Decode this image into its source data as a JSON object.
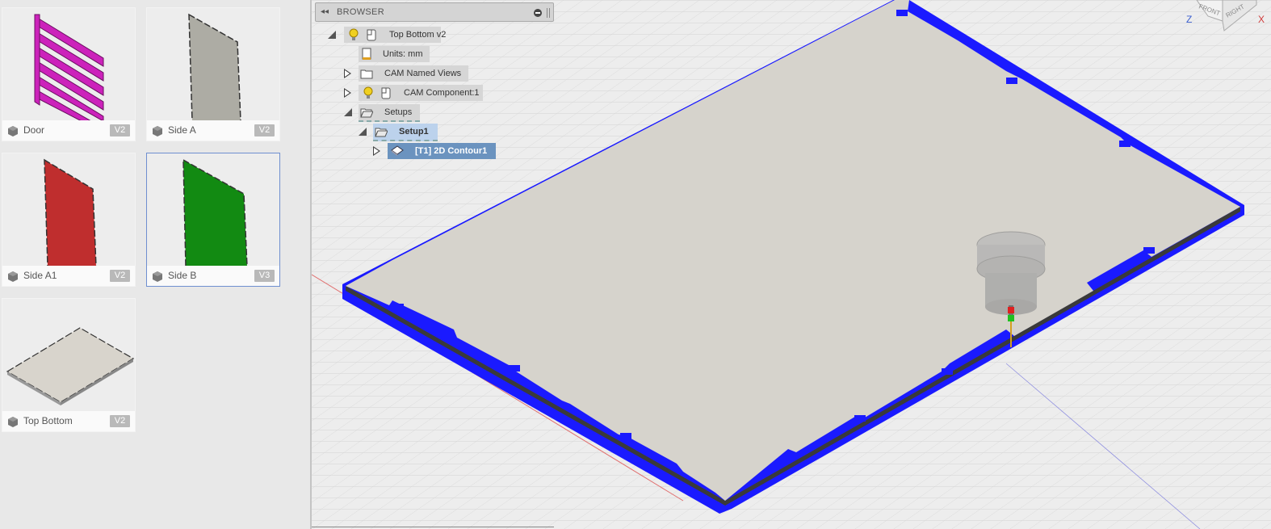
{
  "designs": [
    {
      "name": "Door",
      "version": "V2",
      "color": "#cc22bb",
      "shape": "door"
    },
    {
      "name": "Side A",
      "version": "V2",
      "color": "#adaca4",
      "shape": "panel"
    },
    {
      "name": "Side A1",
      "version": "V2",
      "color": "#bf2e2e",
      "shape": "panel"
    },
    {
      "name": "Side B",
      "version": "V3",
      "color": "#128a12",
      "shape": "panel",
      "selected": true
    },
    {
      "name": "Top Bottom",
      "version": "V2",
      "color": "#d8d4cc",
      "shape": "plate"
    }
  ],
  "browser": {
    "title": "BROWSER",
    "root": "Top Bottom v2",
    "units": "Units: mm",
    "named_views": "CAM Named Views",
    "component": "CAM Component:1",
    "setups": "Setups",
    "setup": "Setup1",
    "operation": "[T1] 2D Contour1"
  },
  "viewcube": {
    "front": "FRONT",
    "right": "RIGHT",
    "axis_z": "Z",
    "axis_x": "X"
  },
  "colors": {
    "toolpath": "#1a1aff",
    "plate": "#d6d3cc",
    "selection": "#6b93bf",
    "grid": "#cfcfcf"
  }
}
